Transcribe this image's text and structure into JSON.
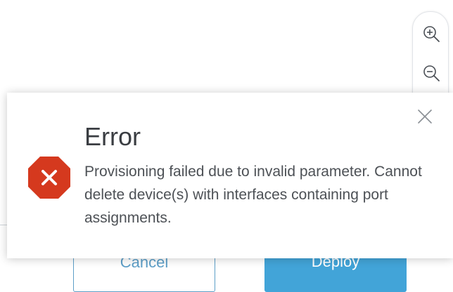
{
  "zoom": {
    "zoom_in_icon": "zoom-in-icon",
    "zoom_out_icon": "zoom-out-icon"
  },
  "footer": {
    "cancel_label": "Cancel",
    "deploy_label": "Deploy"
  },
  "dialog": {
    "title": "Error",
    "message": "Provisioning failed due to invalid parameter. Cannot delete device(s) with interfaces containing port assignments.",
    "status_icon": "error-stop-icon",
    "close_icon": "close-icon"
  },
  "colors": {
    "error_red": "#d5391e",
    "accent_blue": "#42a4d8",
    "text_dark": "#3a3d42"
  }
}
